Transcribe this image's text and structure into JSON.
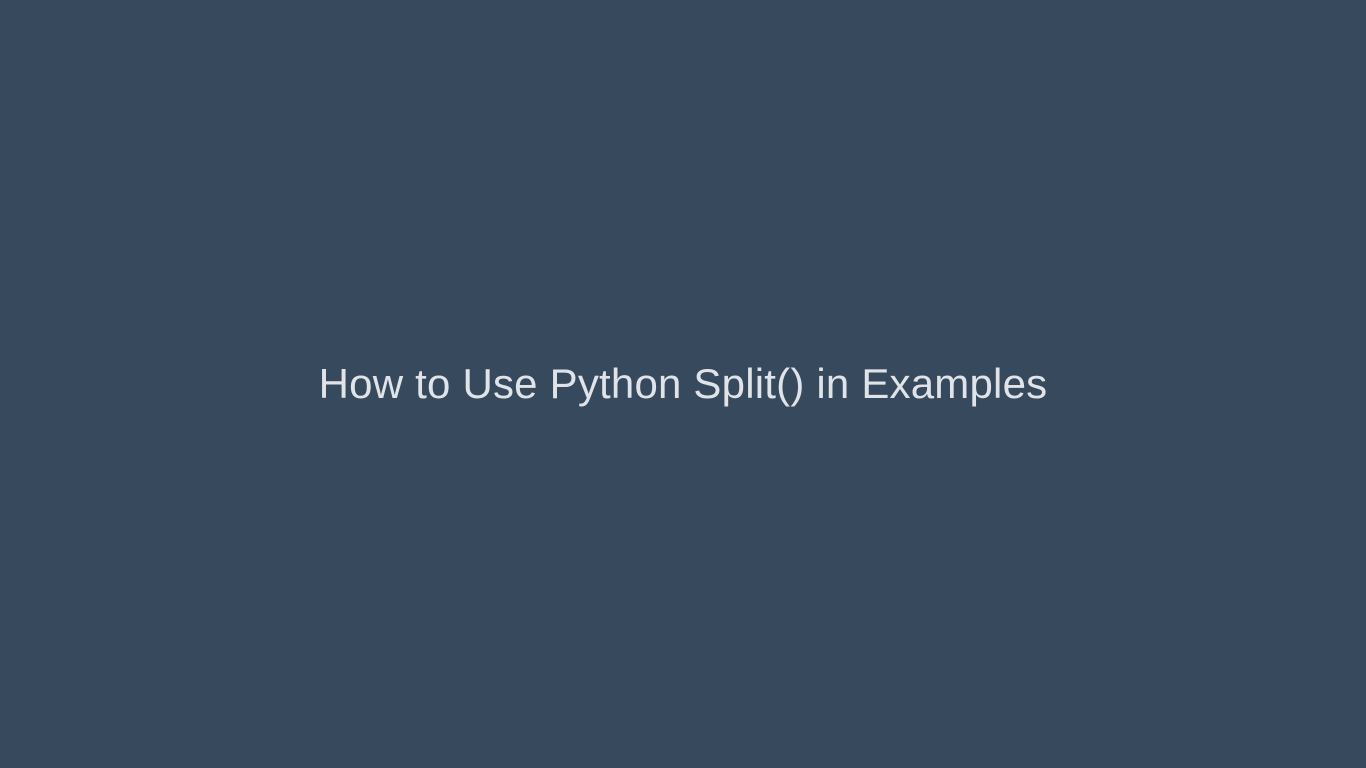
{
  "slide": {
    "title": "How to Use Python Split() in Examples",
    "background_color": "#37495d",
    "text_color": "#e0e4e8"
  }
}
